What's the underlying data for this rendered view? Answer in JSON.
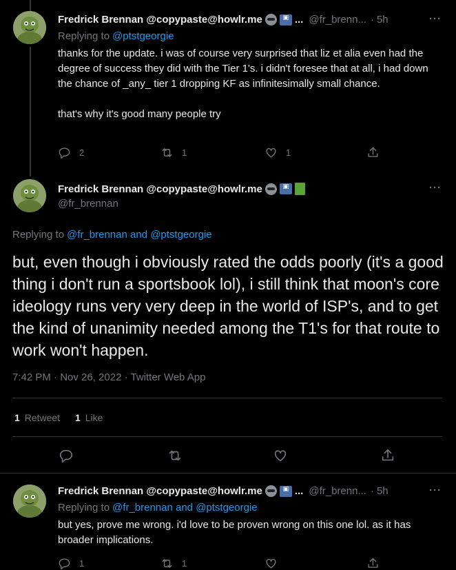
{
  "tweet1": {
    "display_name": "Fredrick Brennan @copypaste@howlr.me",
    "handle": "@fr_brenn...",
    "time": "5h",
    "replying_prefix": "Replying to",
    "replying_to": "@ptstgeorgie",
    "body_p1": "thanks for the update. i was of course very surprised that liz et alia even had the degree of success they did with the Tier 1's. i didn't foresee that at all, i had down the chance of _any_ tier 1 dropping KF as infinitesimally small chance.",
    "body_p2": "that's why it's good many people try",
    "replies": "2",
    "retweets": "1",
    "likes": "1"
  },
  "main": {
    "display_name": "Fredrick Brennan @copypaste@howlr.me",
    "handle": "@fr_brennan",
    "replying_prefix": "Replying to",
    "replying_to": "@fr_brennan and @ptstgeorgie",
    "body": "but, even though i obviously rated the odds poorly (it's a good thing i don't run a sportsbook lol), i still think that moon's core ideology runs very very deep in the world of ISP's, and to get the kind of unanimity needed among the T1's for that route to work won't happen.",
    "timestamp": "7:42 PM · Nov 26, 2022 · Twitter Web App",
    "retweet_count": "1",
    "retweet_label": "Retweet",
    "like_count": "1",
    "like_label": "Like"
  },
  "tweet3": {
    "display_name": "Fredrick Brennan @copypaste@howlr.me",
    "handle": "@fr_brenn...",
    "time": "5h",
    "replying_prefix": "Replying to",
    "replying_to": "@fr_brennan and @ptstgeorgie",
    "body": "but yes, prove me wrong. i'd love to be proven wrong on this one lol. as it has broader implications.",
    "replies": "1",
    "retweets": "1"
  },
  "separator_dot": "·",
  "more_dots": "···",
  "ellipsis": "...",
  "colors": {
    "background": "#000000",
    "text": "#e7e9ea",
    "muted": "#71767b",
    "link": "#1d9bf0",
    "border": "#2f3336"
  }
}
